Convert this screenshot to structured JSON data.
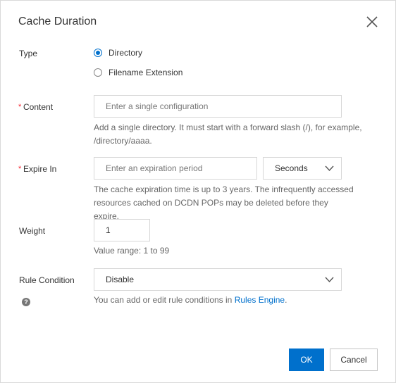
{
  "dialog": {
    "title": "Cache Duration",
    "close_icon": "close-icon"
  },
  "type": {
    "label": "Type",
    "options": [
      {
        "label": "Directory",
        "selected": true
      },
      {
        "label": "Filename Extension",
        "selected": false
      }
    ]
  },
  "content": {
    "required_mark": "*",
    "label": "Content",
    "placeholder": "Enter a single configuration",
    "help": "Add a single directory. It must start with a forward slash (/), for example, /directory/aaaa."
  },
  "expire": {
    "required_mark": "*",
    "label": "Expire In",
    "placeholder": "Enter an expiration period",
    "unit": "Seconds",
    "help": "The cache expiration time is up to 3 years. The infrequently accessed resources cached on DCDN POPs may be deleted before they expire."
  },
  "weight": {
    "label": "Weight",
    "value": "1",
    "help": "Value range: 1 to 99"
  },
  "rule_condition": {
    "label": "Rule Condition",
    "value": "Disable",
    "help_prefix": "You can add or edit rule conditions in ",
    "help_link": "Rules Engine",
    "help_suffix": ".",
    "info_icon": "question-circle-icon"
  },
  "buttons": {
    "ok": "OK",
    "cancel": "Cancel"
  },
  "colors": {
    "accent": "#0070cc",
    "required": "#f5222d"
  }
}
